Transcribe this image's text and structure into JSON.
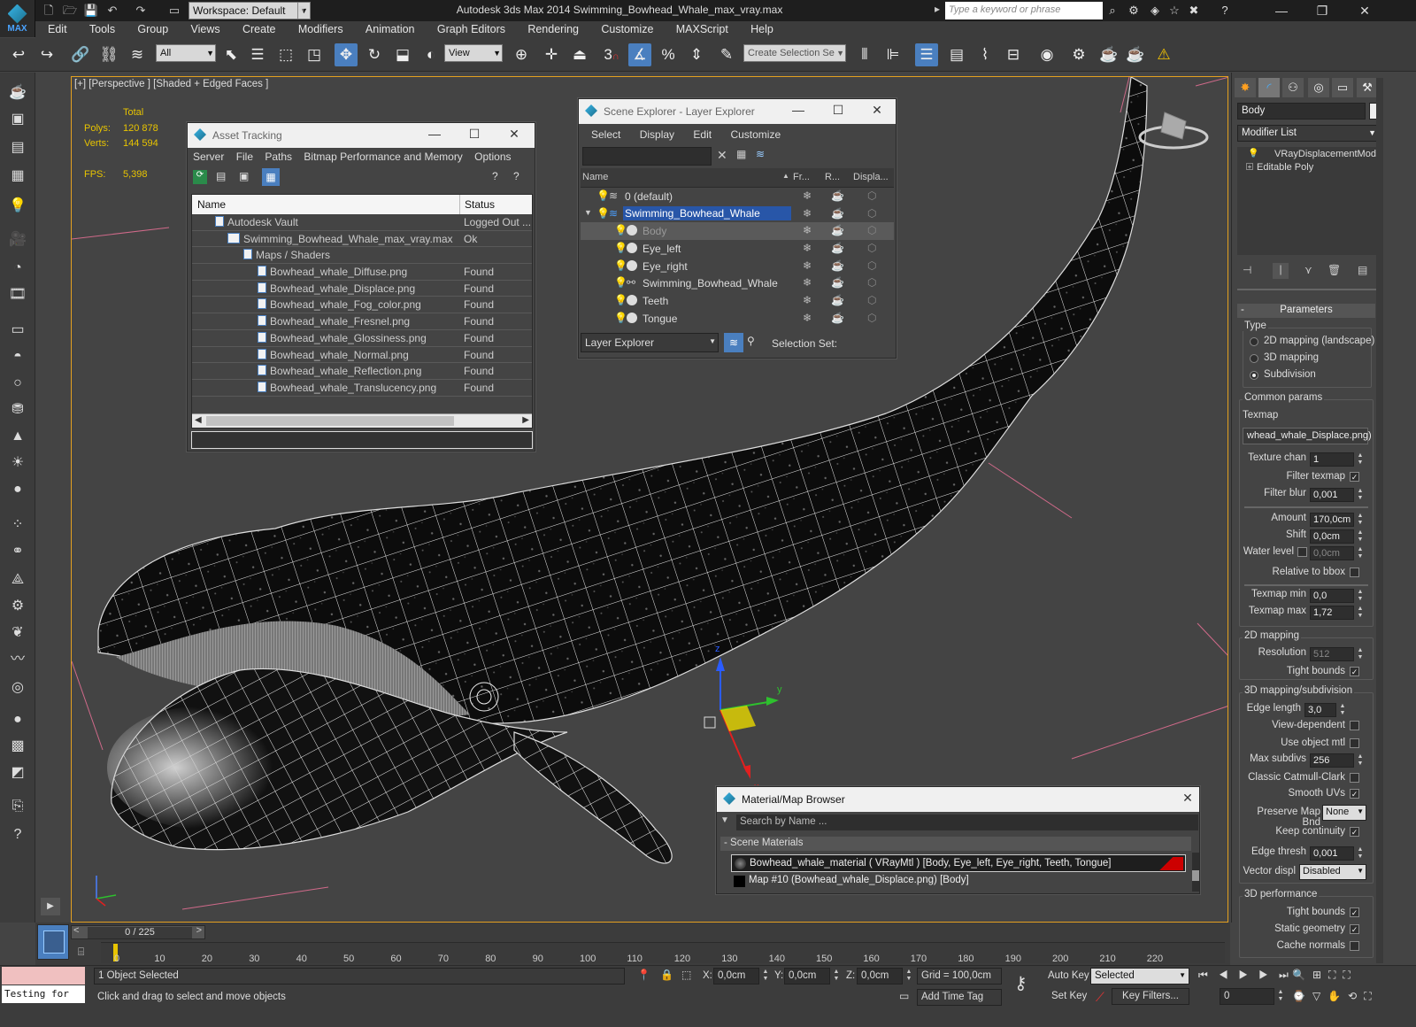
{
  "titlebar": {
    "workspace": "Workspace: Default",
    "app_title": "Autodesk 3ds Max  2014     Swimming_Bowhead_Whale_max_vray.max",
    "search_placeholder": "Type a keyword or phrase",
    "logo_text": "MAX"
  },
  "menu": [
    "Edit",
    "Tools",
    "Group",
    "Views",
    "Create",
    "Modifiers",
    "Animation",
    "Graph Editors",
    "Rendering",
    "Customize",
    "MAXScript",
    "Help"
  ],
  "toolbar": {
    "filter_value": "All",
    "refcoord_value": "View",
    "selection_set_placeholder": "Create Selection Se",
    "snap_label": "3"
  },
  "viewport": {
    "label": "[+] [Perspective ] [Shaded + Edged Faces ]",
    "stats": {
      "total_label": "Total",
      "polys_label": "Polys:",
      "polys_value": "120 878",
      "verts_label": "Verts:",
      "verts_value": "144 594",
      "fps_label": "FPS:",
      "fps_value": "5,398"
    },
    "gizmo": {
      "x": "x",
      "y": "y",
      "z": "z"
    }
  },
  "asset_tracking": {
    "title": "Asset Tracking",
    "menu": [
      "Server",
      "File",
      "Paths",
      "Bitmap Performance and Memory",
      "Options"
    ],
    "col_name": "Name",
    "col_status": "Status",
    "rows": [
      {
        "name": "Autodesk Vault",
        "status": "Logged Out ..."
      },
      {
        "name": "Swimming_Bowhead_Whale_max_vray.max",
        "status": "Ok"
      },
      {
        "name": "Maps / Shaders",
        "status": ""
      },
      {
        "name": "Bowhead_whale_Diffuse.png",
        "status": "Found"
      },
      {
        "name": "Bowhead_whale_Displace.png",
        "status": "Found"
      },
      {
        "name": "Bowhead_whale_Fog_color.png",
        "status": "Found"
      },
      {
        "name": "Bowhead_whale_Fresnel.png",
        "status": "Found"
      },
      {
        "name": "Bowhead_whale_Glossiness.png",
        "status": "Found"
      },
      {
        "name": "Bowhead_whale_Normal.png",
        "status": "Found"
      },
      {
        "name": "Bowhead_whale_Reflection.png",
        "status": "Found"
      },
      {
        "name": "Bowhead_whale_Translucency.png",
        "status": "Found"
      }
    ]
  },
  "scene_explorer": {
    "title": "Scene Explorer - Layer Explorer",
    "menu": [
      "Select",
      "Display",
      "Edit",
      "Customize"
    ],
    "cols": [
      "Name",
      "Fr...",
      "R...",
      "Displa..."
    ],
    "rows": [
      {
        "name": "0 (default)"
      },
      {
        "name": "Swimming_Bowhead_Whale"
      },
      {
        "name": "Body"
      },
      {
        "name": "Eye_left"
      },
      {
        "name": "Eye_right"
      },
      {
        "name": "Swimming_Bowhead_Whale"
      },
      {
        "name": "Teeth"
      },
      {
        "name": "Tongue"
      }
    ],
    "footer_dropdown": "Layer Explorer",
    "selection_set_label": "Selection Set:"
  },
  "material_browser": {
    "title": "Material/Map Browser",
    "search_placeholder": "Search by Name ...",
    "section": "- Scene Materials",
    "items": [
      "Bowhead_whale_material  ( VRayMtl )  [Body, Eye_left, Eye_right, Teeth, Tongue]",
      "Map #10 (Bowhead_whale_Displace.png) [Body]"
    ]
  },
  "command_panel": {
    "object_name": "Body",
    "modifier_list": "Modifier List",
    "stack": [
      "VRayDisplacementMod",
      "Editable Poly"
    ],
    "rollout_title": "Parameters",
    "type_label": "Type",
    "type_options": [
      "2D mapping (landscape)",
      "3D mapping",
      "Subdivision"
    ],
    "common_params": "Common params",
    "texmap_label": "Texmap",
    "texmap_value": "whead_whale_Displace.png)",
    "texture_chan_label": "Texture chan",
    "texture_chan_value": "1",
    "filter_texmap_label": "Filter texmap",
    "filter_blur_label": "Filter blur",
    "filter_blur_value": "0,001",
    "amount_label": "Amount",
    "amount_value": "170,0cm",
    "shift_label": "Shift",
    "shift_value": "0,0cm",
    "water_level_label": "Water level",
    "water_level_value": "0,0cm",
    "relative_bbox_label": "Relative to bbox",
    "texmap_min_label": "Texmap min",
    "texmap_min_value": "0,0",
    "texmap_max_label": "Texmap max",
    "texmap_max_value": "1,72",
    "mapping2d_label": "2D mapping",
    "resolution_label": "Resolution",
    "resolution_value": "512",
    "tight_bounds_label": "Tight bounds",
    "mapping3d_label": "3D mapping/subdivision",
    "edge_length_label": "Edge length",
    "edge_length_value": "3,0",
    "view_dependent_label": "View-dependent",
    "use_object_mtl_label": "Use object mtl",
    "max_subdivs_label": "Max subdivs",
    "max_subdivs_value": "256",
    "classic_cc_label": "Classic Catmull-Clark",
    "smooth_uvs_label": "Smooth UVs",
    "preserve_map_label": "Preserve Map Bnd",
    "preserve_map_value": "None",
    "keep_continuity_label": "Keep continuity",
    "edge_thresh_label": "Edge thresh",
    "edge_thresh_value": "0,001",
    "vector_displ_label": "Vector displ",
    "vector_displ_value": "Disabled",
    "perf_label": "3D performance",
    "perf_tight_bounds_label": "Tight bounds",
    "static_geometry_label": "Static geometry",
    "cache_normals_label": "Cache normals"
  },
  "timeline": {
    "frame_counter": "0 / 225",
    "ticks": [
      "0",
      "10",
      "20",
      "30",
      "40",
      "50",
      "60",
      "70",
      "80",
      "90",
      "100",
      "110",
      "120",
      "130",
      "140",
      "150",
      "160",
      "170",
      "180",
      "190",
      "200",
      "210",
      "220"
    ]
  },
  "status": {
    "script_listener": "Testing for",
    "selected_text": "1 Object Selected",
    "prompt_text": "Click and drag to select and move objects",
    "x_label": "X:",
    "x_value": "0,0cm",
    "y_label": "Y:",
    "y_value": "0,0cm",
    "z_label": "Z:",
    "z_value": "0,0cm",
    "grid": "Grid = 100,0cm",
    "add_time_tag": "Add Time Tag",
    "auto_key": "Auto Key",
    "set_key": "Set Key",
    "selected_dropdown": "Selected",
    "key_filters": "Key Filters...",
    "frame_value": "0"
  },
  "colors": {
    "accent": "#4a7fbf",
    "viewport_border": "#e3a020",
    "stats_yellow": "#e8c400"
  }
}
